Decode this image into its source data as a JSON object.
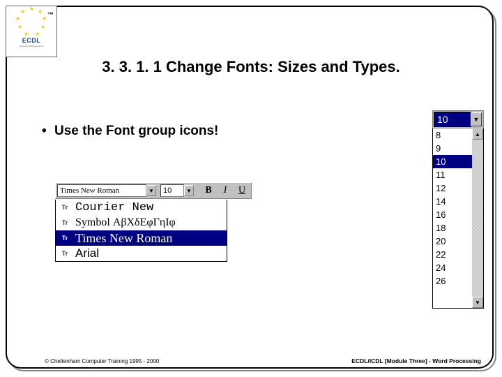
{
  "logo": {
    "label": "ECDL",
    "tm": "™"
  },
  "title": "3. 3. 1. 1 Change Fonts: Sizes and Types.",
  "bullet": "Use the Font group icons!",
  "toolbar": {
    "font_combo": "Times New Roman",
    "size_combo": "10",
    "bold": "B",
    "italic": "I",
    "underline": "U"
  },
  "font_list": {
    "items": [
      {
        "name": "Courier New",
        "class": "courier"
      },
      {
        "name": "Symbol ΑβΧδΕφΓηΙφ",
        "class": "symbol"
      },
      {
        "name": "Times New Roman",
        "class": "tnr",
        "selected": true
      },
      {
        "name": "Arial",
        "class": "arial-f"
      }
    ]
  },
  "size_dropdown": {
    "current": "10",
    "items": [
      "8",
      "9",
      "10",
      "11",
      "12",
      "14",
      "16",
      "18",
      "20",
      "22",
      "24",
      "26"
    ],
    "selected_index": 2,
    "scroll_up": "▲",
    "scroll_down": "▼"
  },
  "footer": {
    "left": "© Cheltenham Computer Training 1995 - 2000",
    "right": "ECDL/ICDL [Module Three]  - Word Processing"
  },
  "icons": {
    "dropdown": "▼"
  }
}
